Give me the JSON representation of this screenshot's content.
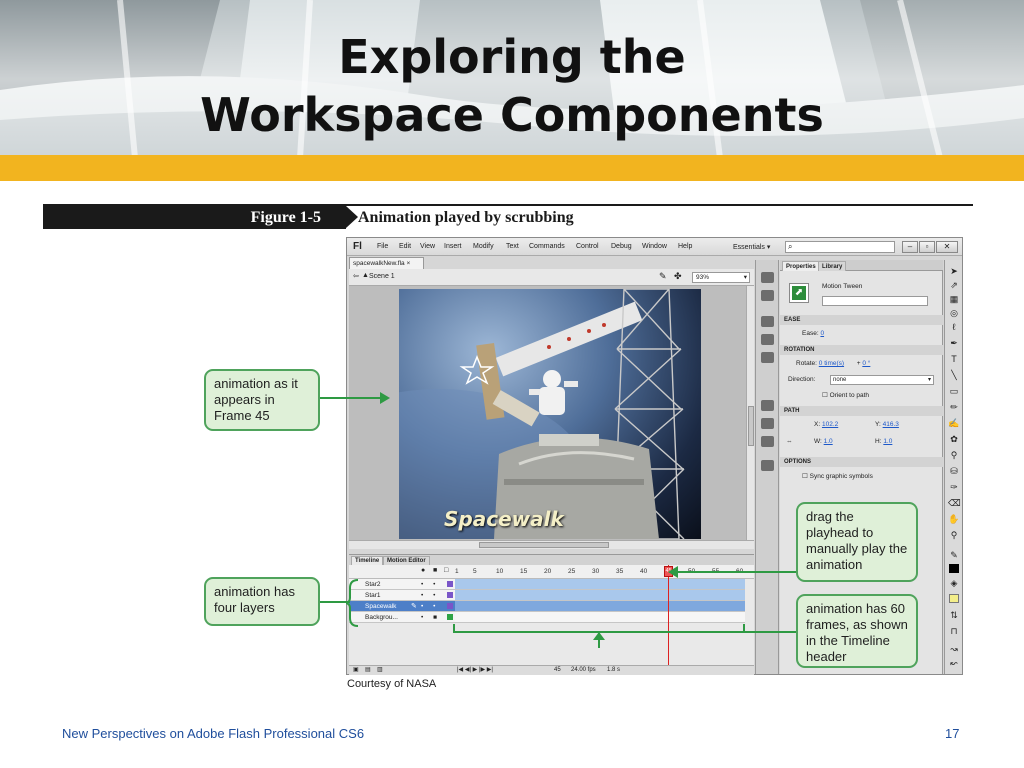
{
  "slide": {
    "title_line1": "Exploring the",
    "title_line2": "Workspace Components",
    "footer_left": "New Perspectives on Adobe Flash Professional CS6",
    "page_number": "17",
    "colors": {
      "accent_bar": "#f2b41f",
      "callout_fill": "#dff0d8",
      "callout_border": "#4fa35c",
      "footer_text": "#1f4e9c"
    }
  },
  "figure": {
    "number": "Figure 1-5",
    "caption": "Animation played by scrubbing",
    "credit": "Courtesy of NASA"
  },
  "flash": {
    "logo": "Fl",
    "menu": [
      "File",
      "Edit",
      "View",
      "Insert",
      "Modify",
      "Text",
      "Commands",
      "Control",
      "Debug",
      "Window",
      "Help"
    ],
    "workspace": "Essentials ▾",
    "window_buttons": [
      "–",
      "▫",
      "✕"
    ],
    "doc_tab": "spacewalkNew.fla ×",
    "scene": "Scene 1",
    "zoom": "93%",
    "stage_text": "Spacewalk",
    "timeline_tabs": [
      "Timeline",
      "Motion Editor"
    ],
    "frame_numbers": [
      "1",
      "5",
      "10",
      "15",
      "20",
      "25",
      "30",
      "35",
      "40",
      "45",
      "50",
      "55",
      "60"
    ],
    "current_frame": 45,
    "total_frames": 60,
    "layers": [
      {
        "name": "Star2",
        "selected": false,
        "swatch": "#7a56c8"
      },
      {
        "name": "Star1",
        "selected": false,
        "swatch": "#7a56c8"
      },
      {
        "name": "Spacewalk",
        "selected": true,
        "swatch": "#7a56c8"
      },
      {
        "name": "Backgrou...",
        "selected": false,
        "swatch": "#2fa346"
      }
    ],
    "timeline_footer": {
      "frame": "45",
      "fps": "24.00 fps",
      "time": "1.8 s"
    },
    "properties": {
      "tabs": [
        "Properties",
        "Library"
      ],
      "type": "Motion Tween",
      "sections": [
        "EASE",
        "ROTATION",
        "PATH",
        "OPTIONS"
      ],
      "ease_label": "Ease:",
      "ease_value": "0",
      "rotate_label": "Rotate:",
      "rotate_times": "0 time(s)",
      "rotate_plus": "+",
      "rotate_degrees": "0 °",
      "direction_label": "Direction:",
      "direction_value": "none",
      "orient_label": "Orient to path",
      "x_label": "X:",
      "x_value": "102.2",
      "y_label": "Y:",
      "y_value": "416.3",
      "w_label": "W:",
      "w_value": "1.0",
      "h_label": "H:",
      "h_value": "1.0",
      "sync_label": "Sync graphic symbols"
    }
  },
  "callouts": {
    "frame45": "animation as it appears in Frame 45",
    "layers": "animation has four layers",
    "playhead": "drag the playhead to manually play the animation",
    "frames": "animation has 60 frames, as shown in the Timeline header"
  }
}
